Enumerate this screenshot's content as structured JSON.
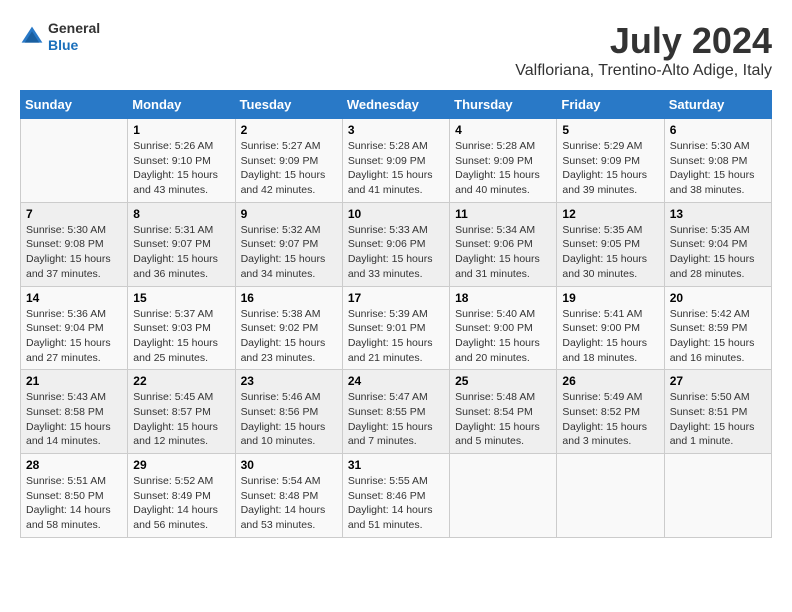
{
  "logo": {
    "general": "General",
    "blue": "Blue"
  },
  "title": "July 2024",
  "subtitle": "Valfloriana, Trentino-Alto Adige, Italy",
  "days_of_week": [
    "Sunday",
    "Monday",
    "Tuesday",
    "Wednesday",
    "Thursday",
    "Friday",
    "Saturday"
  ],
  "weeks": [
    [
      {
        "day": "",
        "info": ""
      },
      {
        "day": "1",
        "info": "Sunrise: 5:26 AM\nSunset: 9:10 PM\nDaylight: 15 hours and 43 minutes."
      },
      {
        "day": "2",
        "info": "Sunrise: 5:27 AM\nSunset: 9:09 PM\nDaylight: 15 hours and 42 minutes."
      },
      {
        "day": "3",
        "info": "Sunrise: 5:28 AM\nSunset: 9:09 PM\nDaylight: 15 hours and 41 minutes."
      },
      {
        "day": "4",
        "info": "Sunrise: 5:28 AM\nSunset: 9:09 PM\nDaylight: 15 hours and 40 minutes."
      },
      {
        "day": "5",
        "info": "Sunrise: 5:29 AM\nSunset: 9:09 PM\nDaylight: 15 hours and 39 minutes."
      },
      {
        "day": "6",
        "info": "Sunrise: 5:30 AM\nSunset: 9:08 PM\nDaylight: 15 hours and 38 minutes."
      }
    ],
    [
      {
        "day": "7",
        "info": "Sunrise: 5:30 AM\nSunset: 9:08 PM\nDaylight: 15 hours and 37 minutes."
      },
      {
        "day": "8",
        "info": "Sunrise: 5:31 AM\nSunset: 9:07 PM\nDaylight: 15 hours and 36 minutes."
      },
      {
        "day": "9",
        "info": "Sunrise: 5:32 AM\nSunset: 9:07 PM\nDaylight: 15 hours and 34 minutes."
      },
      {
        "day": "10",
        "info": "Sunrise: 5:33 AM\nSunset: 9:06 PM\nDaylight: 15 hours and 33 minutes."
      },
      {
        "day": "11",
        "info": "Sunrise: 5:34 AM\nSunset: 9:06 PM\nDaylight: 15 hours and 31 minutes."
      },
      {
        "day": "12",
        "info": "Sunrise: 5:35 AM\nSunset: 9:05 PM\nDaylight: 15 hours and 30 minutes."
      },
      {
        "day": "13",
        "info": "Sunrise: 5:35 AM\nSunset: 9:04 PM\nDaylight: 15 hours and 28 minutes."
      }
    ],
    [
      {
        "day": "14",
        "info": "Sunrise: 5:36 AM\nSunset: 9:04 PM\nDaylight: 15 hours and 27 minutes."
      },
      {
        "day": "15",
        "info": "Sunrise: 5:37 AM\nSunset: 9:03 PM\nDaylight: 15 hours and 25 minutes."
      },
      {
        "day": "16",
        "info": "Sunrise: 5:38 AM\nSunset: 9:02 PM\nDaylight: 15 hours and 23 minutes."
      },
      {
        "day": "17",
        "info": "Sunrise: 5:39 AM\nSunset: 9:01 PM\nDaylight: 15 hours and 21 minutes."
      },
      {
        "day": "18",
        "info": "Sunrise: 5:40 AM\nSunset: 9:00 PM\nDaylight: 15 hours and 20 minutes."
      },
      {
        "day": "19",
        "info": "Sunrise: 5:41 AM\nSunset: 9:00 PM\nDaylight: 15 hours and 18 minutes."
      },
      {
        "day": "20",
        "info": "Sunrise: 5:42 AM\nSunset: 8:59 PM\nDaylight: 15 hours and 16 minutes."
      }
    ],
    [
      {
        "day": "21",
        "info": "Sunrise: 5:43 AM\nSunset: 8:58 PM\nDaylight: 15 hours and 14 minutes."
      },
      {
        "day": "22",
        "info": "Sunrise: 5:45 AM\nSunset: 8:57 PM\nDaylight: 15 hours and 12 minutes."
      },
      {
        "day": "23",
        "info": "Sunrise: 5:46 AM\nSunset: 8:56 PM\nDaylight: 15 hours and 10 minutes."
      },
      {
        "day": "24",
        "info": "Sunrise: 5:47 AM\nSunset: 8:55 PM\nDaylight: 15 hours and 7 minutes."
      },
      {
        "day": "25",
        "info": "Sunrise: 5:48 AM\nSunset: 8:54 PM\nDaylight: 15 hours and 5 minutes."
      },
      {
        "day": "26",
        "info": "Sunrise: 5:49 AM\nSunset: 8:52 PM\nDaylight: 15 hours and 3 minutes."
      },
      {
        "day": "27",
        "info": "Sunrise: 5:50 AM\nSunset: 8:51 PM\nDaylight: 15 hours and 1 minute."
      }
    ],
    [
      {
        "day": "28",
        "info": "Sunrise: 5:51 AM\nSunset: 8:50 PM\nDaylight: 14 hours and 58 minutes."
      },
      {
        "day": "29",
        "info": "Sunrise: 5:52 AM\nSunset: 8:49 PM\nDaylight: 14 hours and 56 minutes."
      },
      {
        "day": "30",
        "info": "Sunrise: 5:54 AM\nSunset: 8:48 PM\nDaylight: 14 hours and 53 minutes."
      },
      {
        "day": "31",
        "info": "Sunrise: 5:55 AM\nSunset: 8:46 PM\nDaylight: 14 hours and 51 minutes."
      },
      {
        "day": "",
        "info": ""
      },
      {
        "day": "",
        "info": ""
      },
      {
        "day": "",
        "info": ""
      }
    ]
  ]
}
